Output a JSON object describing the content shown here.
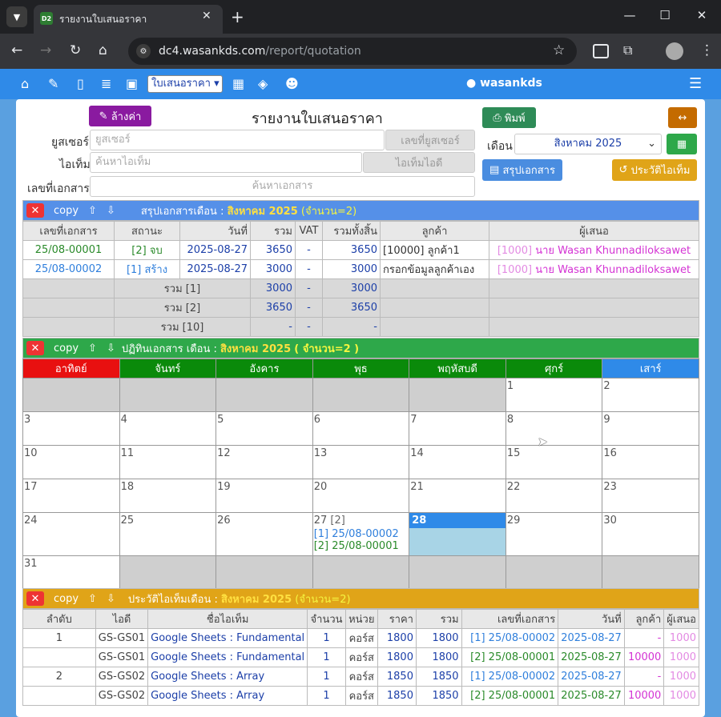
{
  "browser": {
    "tab_title": "รายงานใบเสนอราคา",
    "favicon_text": "D2",
    "url_host": "dc4.wasankds.com",
    "url_path": "/report/quotation"
  },
  "nav": {
    "select_value": "ใบเสนอราคา",
    "user": "wasankds"
  },
  "toolbar": {
    "clear": "ล้างค่า",
    "title": "รายงานใบเสนอราคา",
    "print": "พิมพ์",
    "month_label": "เดือน",
    "month_value": "สิงหาคม 2025",
    "summary": "สรุปเอกสาร",
    "history": "ประวัติไอเท็ม"
  },
  "form": {
    "user_label": "ยูสเซอร์",
    "user_placeholder": "ยูสเซอร์",
    "user_id_placeholder": "เลขที่ยูสเซอร์",
    "item_label": "ไอเท็ม",
    "item_placeholder": "ค้นหาไอเท็ม",
    "item_id_placeholder": "ไอเท็มไอดี",
    "doc_label": "เลขที่เอกสาร",
    "doc_placeholder": "ค้นหาเอกสาร"
  },
  "common": {
    "copy": "copy",
    "up": "⇧",
    "down": "⇩"
  },
  "summary": {
    "title": "สรุปเอกสารเดือน :",
    "month": "สิงหาคม 2025",
    "count": "(จำนวน=2)",
    "headers": [
      "เลขที่เอกสาร",
      "สถานะ",
      "วันที่",
      "รวม",
      "VAT",
      "รวมทั้งสิ้น",
      "ลูกค้า",
      "ผู้เสนอ"
    ],
    "rows": [
      [
        "25/08-00001",
        "[2] จบ",
        "2025-08-27",
        "3650",
        "-",
        "3650",
        "[10000] ลูกค้า1",
        "[1000]",
        "นาย Wasan Khunnadiloksawet"
      ],
      [
        "25/08-00002",
        "[1] สร้าง",
        "2025-08-27",
        "3000",
        "-",
        "3000",
        "กรอกข้อมูลลูกค้าเอง",
        "[1000]",
        "นาย Wasan Khunnadiloksawet"
      ]
    ],
    "totals": [
      [
        "รวม [1]",
        "3000",
        "-",
        "3000"
      ],
      [
        "รวม [2]",
        "3650",
        "-",
        "3650"
      ],
      [
        "รวม [10]",
        "-",
        "-",
        "-"
      ]
    ]
  },
  "calendar": {
    "title": "ปฏิทินเอกสาร เดือน :",
    "month": "สิงหาคม 2025",
    "count": "( จำนวน=2 )",
    "days": [
      "อาทิตย์",
      "จันทร์",
      "อังคาร",
      "พุธ",
      "พฤหัสบดี",
      "ศุกร์",
      "เสาร์"
    ],
    "day_colors": [
      "#e81010",
      "#0a8a0a",
      "#0a8a0a",
      "#0a8a0a",
      "#0a8a0a",
      "#0a8a0a",
      "#2f8ae8"
    ],
    "d27_count": "[2]",
    "d27_docs": [
      "[1] 25/08-00002",
      "[2] 25/08-00001"
    ]
  },
  "history": {
    "title": "ประวัติไอเท็มเดือน :",
    "month": "สิงหาคม 2025",
    "count": "(จำนวน=2)",
    "headers": [
      "ลำดับ",
      "ไอดี",
      "ชื่อไอเท็ม",
      "จำนวน",
      "หน่วย",
      "ราคา",
      "รวม",
      "เลขที่เอกสาร",
      "วันที่",
      "ลูกค้า",
      "ผู้เสนอ"
    ],
    "rows": [
      [
        "1",
        "GS-GS01",
        "Google Sheets : Fundamental",
        "1",
        "คอร์ส",
        "1800",
        "1800",
        "[1] 25/08-00002",
        "2025-08-27",
        "-",
        "1000"
      ],
      [
        "",
        "GS-GS01",
        "Google Sheets : Fundamental",
        "1",
        "คอร์ส",
        "1800",
        "1800",
        "[2] 25/08-00001",
        "2025-08-27",
        "10000",
        "1000"
      ],
      [
        "2",
        "GS-GS02",
        "Google Sheets : Array",
        "1",
        "คอร์ส",
        "1850",
        "1850",
        "[1] 25/08-00002",
        "2025-08-27",
        "-",
        "1000"
      ],
      [
        "",
        "GS-GS02",
        "Google Sheets : Array",
        "1",
        "คอร์ส",
        "1850",
        "1850",
        "[2] 25/08-00001",
        "2025-08-27",
        "10000",
        "1000"
      ]
    ]
  }
}
